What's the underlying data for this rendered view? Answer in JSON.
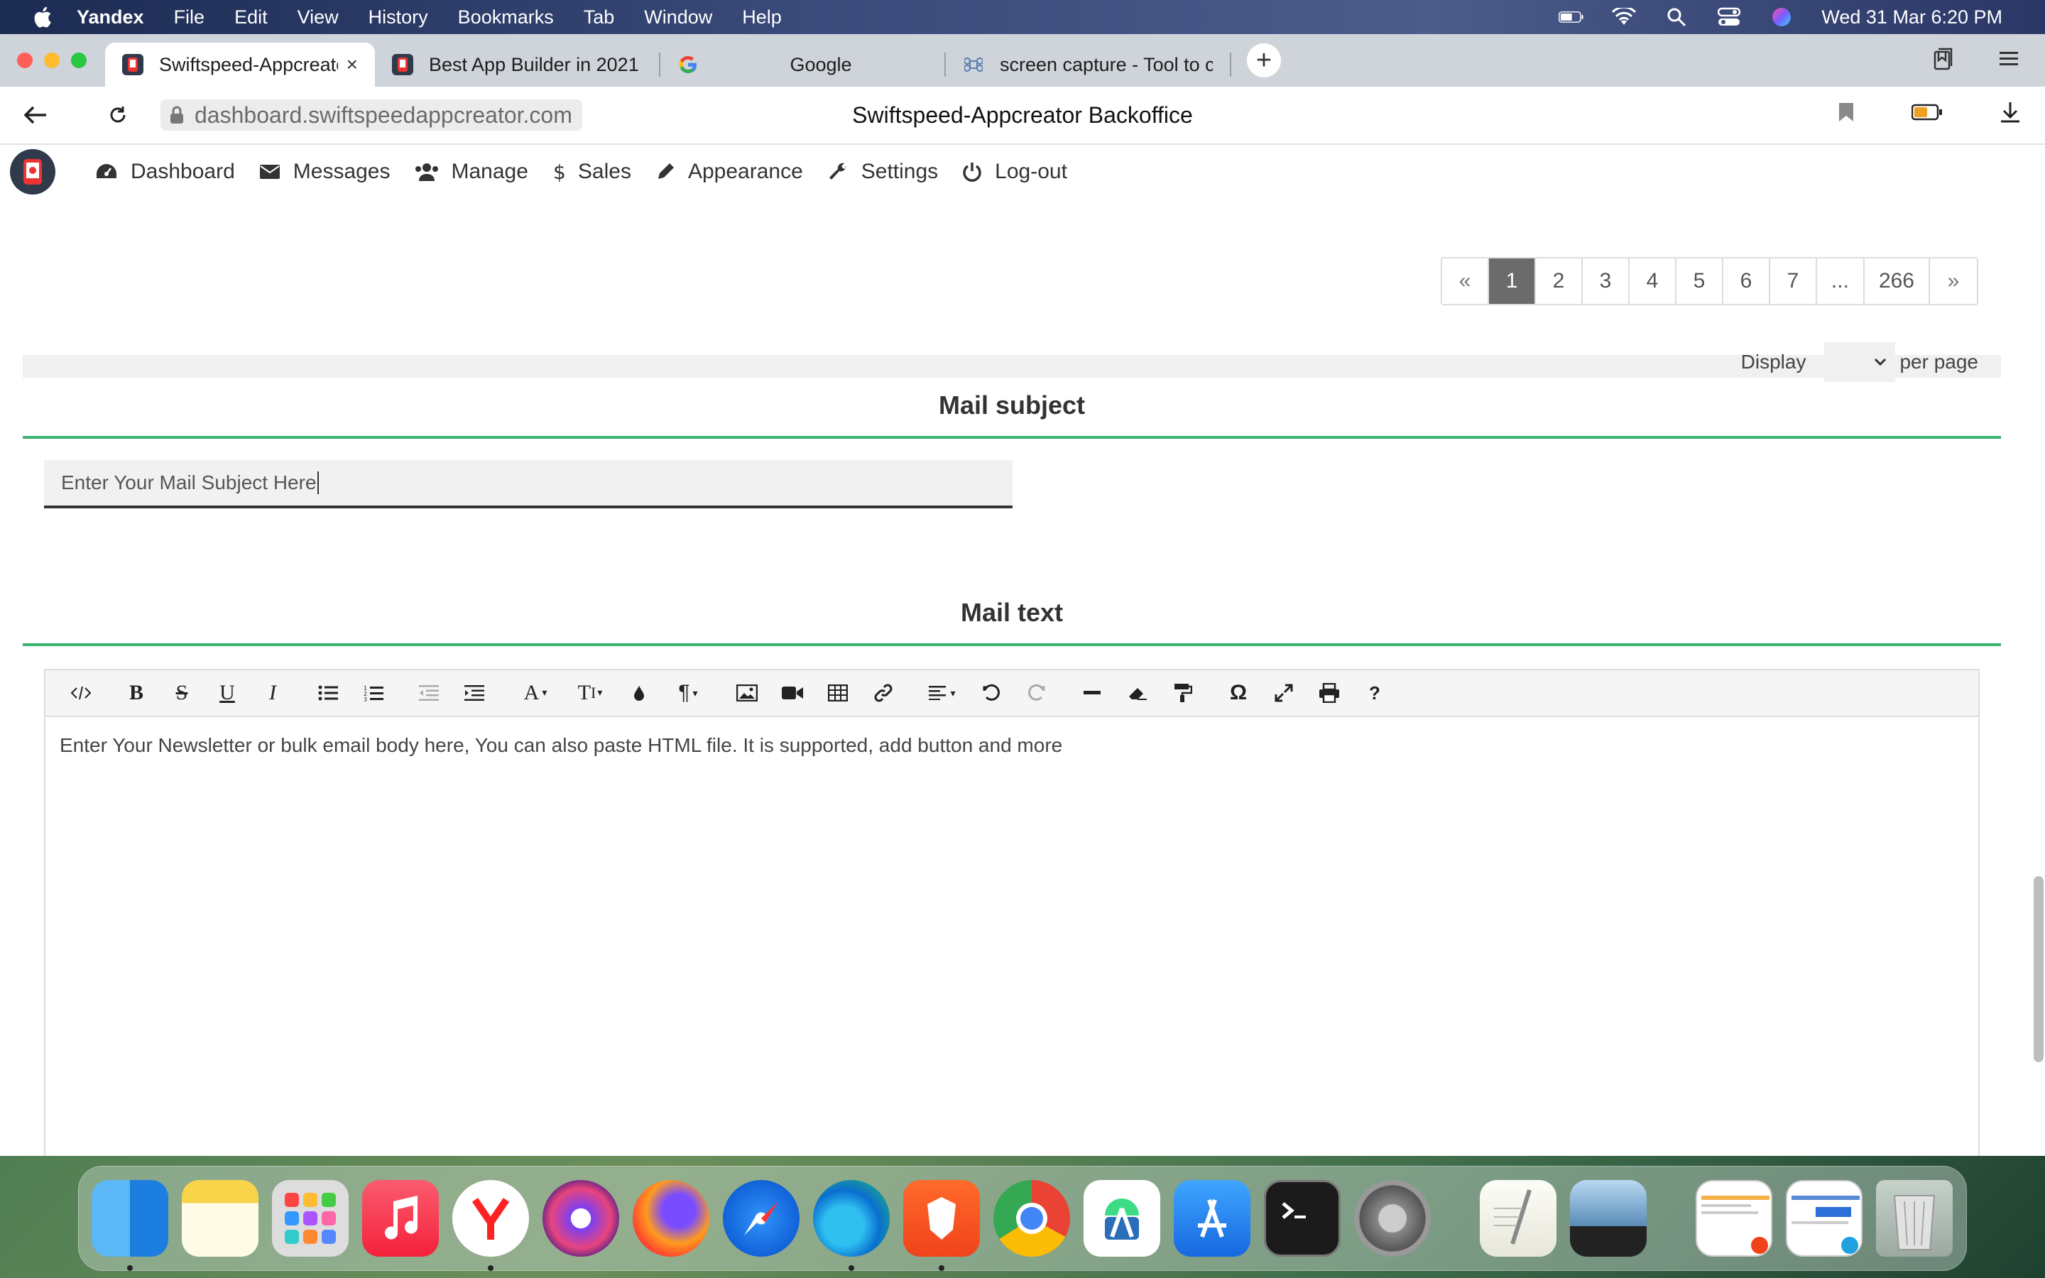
{
  "menubar": {
    "app": "Yandex",
    "items": [
      "File",
      "Edit",
      "View",
      "History",
      "Bookmarks",
      "Tab",
      "Window",
      "Help"
    ],
    "datetime": "Wed 31 Mar  6:20 PM"
  },
  "tabs": [
    {
      "title": "Swiftspeed-Appcreato",
      "close": "×"
    },
    {
      "title": "Best App Builder in 2021"
    },
    {
      "title": "Google"
    },
    {
      "title": "screen capture - Tool to c"
    }
  ],
  "newtab": "+",
  "address": {
    "url": "dashboard.swiftspeedappcreator.com",
    "page_title": "Swiftspeed-Appcreator Backoffice"
  },
  "appnav": {
    "items": [
      "Dashboard",
      "Messages",
      "Manage",
      "Sales",
      "Appearance",
      "Settings",
      "Log-out"
    ]
  },
  "pagination": {
    "prev": "«",
    "pages": [
      "1",
      "2",
      "3",
      "4",
      "5",
      "6",
      "7",
      "...",
      "266"
    ],
    "next": "»",
    "active": "1"
  },
  "display": {
    "label": "Display",
    "suffix": "per page"
  },
  "subject": {
    "heading": "Mail subject",
    "value": "Enter Your Mail Subject Here"
  },
  "mailtext": {
    "heading": "Mail text",
    "body": "Enter Your Newsletter or bulk email body here, You can also paste HTML file. It is supported, add button and more"
  },
  "colors": {
    "accent_green": "#3cb371",
    "active_page": "#6b6b6b"
  }
}
